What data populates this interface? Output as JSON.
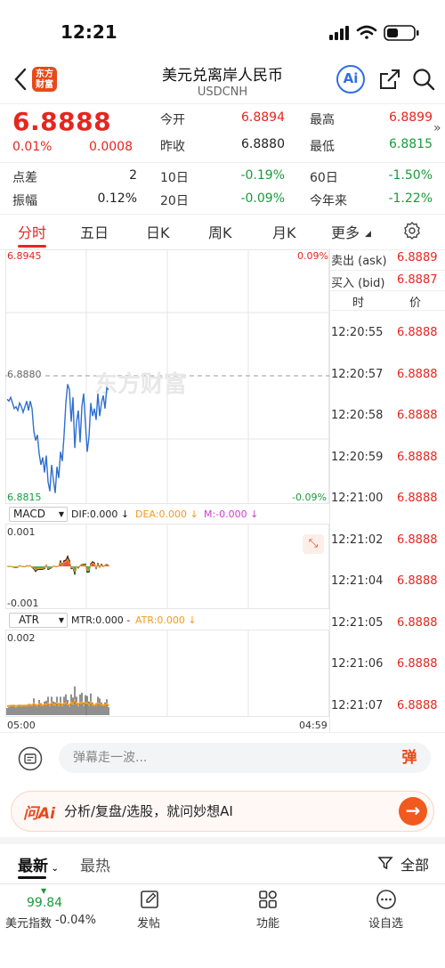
{
  "status_bar": {
    "time": "12:21"
  },
  "header": {
    "logo_text_1": "东方",
    "logo_text_2": "财富",
    "title": "美元兑离岸人民币",
    "subtitle": "USDCNH",
    "ai_label": "Ai"
  },
  "quote": {
    "price": "6.8888",
    "change_pct": "0.01%",
    "change_abs": "0.0008",
    "open_label": "今开",
    "open": "6.8894",
    "high_label": "最高",
    "high": "6.8899",
    "prev_label": "昨收",
    "prev": "6.8880",
    "low_label": "最低",
    "low": "6.8815",
    "spread_label": "点差",
    "spread": "2",
    "d10_label": "10日",
    "d10": "-0.19%",
    "d60_label": "60日",
    "d60": "-1.50%",
    "amp_label": "振幅",
    "amp": "0.12%",
    "d20_label": "20日",
    "d20": "-0.09%",
    "ytd_label": "今年来",
    "ytd": "-1.22%"
  },
  "tabs": [
    "分时",
    "五日",
    "日K",
    "周K",
    "月K",
    "更多"
  ],
  "chart": {
    "top_price": "6.8945",
    "top_pct": "0.09%",
    "bottom_price": "6.8815",
    "bottom_pct": "-0.09%",
    "mid_price": "6.8880",
    "watermark": "东方财富",
    "macd_name": "MACD",
    "macd_dif": "DIF:0.000 ↓",
    "macd_dea": "DEA:0.000 ↓",
    "macd_m": "M:-0.000 ↓",
    "macd_top": "0.001",
    "macd_bottom": "-0.001",
    "atr_name": "ATR",
    "atr_mtr": "MTR:0.000 -",
    "atr_atr": "ATR:0.000 ↓",
    "atr_top": "0.002",
    "time_start": "05:00",
    "time_end": "04:59",
    "colors": {
      "line": "#2f6fd0",
      "up": "#e5261f",
      "down": "#1a9a3a",
      "atr_orange": "#f29b1d"
    }
  },
  "chart_data": {
    "type": "line",
    "series": [
      {
        "values": [
          6.8868,
          6.8867,
          6.8869,
          6.8866,
          6.8863,
          6.8864,
          6.8862,
          6.8866,
          6.8864,
          6.8861,
          6.8864,
          6.8867,
          6.8862,
          6.8867,
          6.8863,
          6.8851,
          6.8846,
          6.8849,
          6.8839,
          6.8833,
          6.8837,
          6.8829,
          6.8838,
          6.8824,
          6.8819,
          6.8833,
          6.8825,
          6.8818,
          6.8832,
          6.8826,
          6.884,
          6.8835,
          6.8849,
          6.8866,
          6.8876,
          6.8873,
          6.8856,
          6.8869,
          6.8842,
          6.8856,
          6.8862,
          6.8845,
          6.8864,
          6.8871,
          6.8855,
          6.884,
          6.8848,
          6.8866,
          6.8859,
          6.8863,
          6.8857,
          6.8871,
          6.8859,
          6.8866,
          6.887,
          6.8863,
          6.8874,
          6.8873
        ]
      }
    ],
    "ylim": [
      6.8815,
      6.8945
    ],
    "x_start": "05:00",
    "x_end": "04:59"
  },
  "side_panel": {
    "ask_label": "卖出 (ask)",
    "ask": "6.8889",
    "bid_label": "买入 (bid)",
    "bid": "6.8887",
    "col_time": "时",
    "col_price": "价",
    "ticks": [
      {
        "time": "12:20:55",
        "price": "6.8888"
      },
      {
        "time": "12:20:57",
        "price": "6.8888"
      },
      {
        "time": "12:20:58",
        "price": "6.8888"
      },
      {
        "time": "12:20:59",
        "price": "6.8888"
      },
      {
        "time": "12:21:00",
        "price": "6.8888"
      },
      {
        "time": "12:21:02",
        "price": "6.8888"
      },
      {
        "time": "12:21:04",
        "price": "6.8888"
      },
      {
        "time": "12:21:05",
        "price": "6.8888"
      },
      {
        "time": "12:21:06",
        "price": "6.8888"
      },
      {
        "time": "12:21:07",
        "price": "6.8888"
      }
    ]
  },
  "danmu": {
    "placeholder": "弹幕走一波...",
    "button": "弹"
  },
  "ai_bar": {
    "brand": "问Ai",
    "text": "分析/复盘/选股，就问妙想AI"
  },
  "feed_tabs": {
    "latest": "最新",
    "hot": "最热",
    "filter": "全部"
  },
  "bottom_nav": {
    "index_value": "99.84",
    "index_label": "美元指数",
    "index_change": "-0.04%",
    "post": "发帖",
    "func": "功能",
    "watch": "设自选"
  }
}
